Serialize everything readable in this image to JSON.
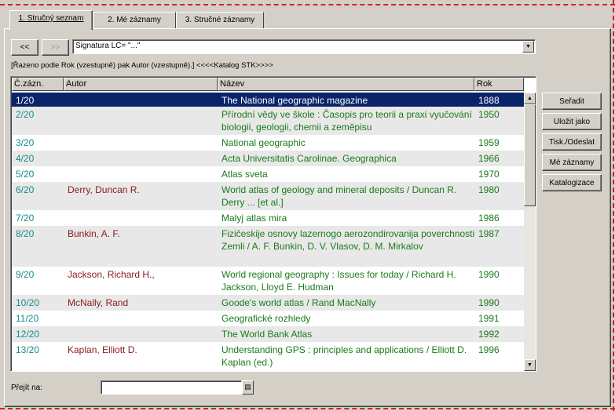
{
  "tabs": [
    {
      "label": "1. Stručný seznam",
      "active": true
    },
    {
      "label": "2. Mé záznamy",
      "active": false
    },
    {
      "label": "3. Stručné záznamy",
      "active": false
    }
  ],
  "nav": {
    "prev_label": "<<",
    "next_label": ">>",
    "query_value": "Signatura LC= \"...\""
  },
  "sort_info": "[Řazeno podle Rok (vzestupně) pak Autor (vzestupně).]     <<<<Katalog STK>>>>",
  "table": {
    "columns": [
      "Č.zázn.",
      "Autor",
      "Název",
      "Rok"
    ],
    "rows": [
      {
        "num": "1/20",
        "author": "",
        "title": "The National geographic magazine",
        "year": "1888",
        "selected": true
      },
      {
        "num": "2/20",
        "author": "",
        "title": "Přírodní vědy ve škole : Časopis pro teorii a praxi vyučování biologii, geologii, chemii a zeměpisu",
        "year": "1950"
      },
      {
        "num": "3/20",
        "author": "",
        "title": "National geographic",
        "year": "1959"
      },
      {
        "num": "4/20",
        "author": "",
        "title": "Acta Universitatis Carolinae. Geographica",
        "year": "1966"
      },
      {
        "num": "5/20",
        "author": "",
        "title": "Atlas sveta",
        "year": "1970"
      },
      {
        "num": "6/20",
        "author": "Derry, Duncan R.",
        "title": "World atlas of geology and mineral deposits / Duncan R. Derry ... [et al.]",
        "year": "1980"
      },
      {
        "num": "7/20",
        "author": "",
        "title": "Malyj atlas mira",
        "year": "1986"
      },
      {
        "num": "8/20",
        "author": "Bunkin, A. F.",
        "title": "Fizičeskije osnovy lazernogo aerozondirovanija poverchnosti Zemli / A. F. Bunkin, D. V. Vlasov, D. M. Mirkalov",
        "year": "1987"
      },
      {
        "num": "9/20",
        "author": "Jackson, Richard H.,",
        "title": "World regional geography : Issues for today / Richard H. Jackson, Lloyd E. Hudman",
        "year": "1990"
      },
      {
        "num": "10/20",
        "author": "McNally, Rand",
        "title": "Goode's world atlas / Rand MacNally",
        "year": "1990"
      },
      {
        "num": "11/20",
        "author": "",
        "title": "Geografické rozhledy",
        "year": "1991"
      },
      {
        "num": "12/20",
        "author": "",
        "title": "The World Bank Atlas",
        "year": "1992"
      },
      {
        "num": "13/20",
        "author": "Kaplan, Elliott D.",
        "title": "Understanding GPS : principles and applications / Elliott D. Kaplan (ed.)",
        "year": "1996"
      }
    ]
  },
  "actions": {
    "sort": "Seřadit",
    "save_as": "Uložit jako",
    "print_send": "Tisk./Odeslat",
    "my_records": "Mé záznamy",
    "cataloging": "Katalogizace"
  },
  "goto": {
    "label": "Přejít na:",
    "value": ""
  },
  "colors": {
    "number": "#1a8a8a",
    "author": "#8b1a1a",
    "title": "#1a7a1a",
    "selection": "#0a246a"
  }
}
